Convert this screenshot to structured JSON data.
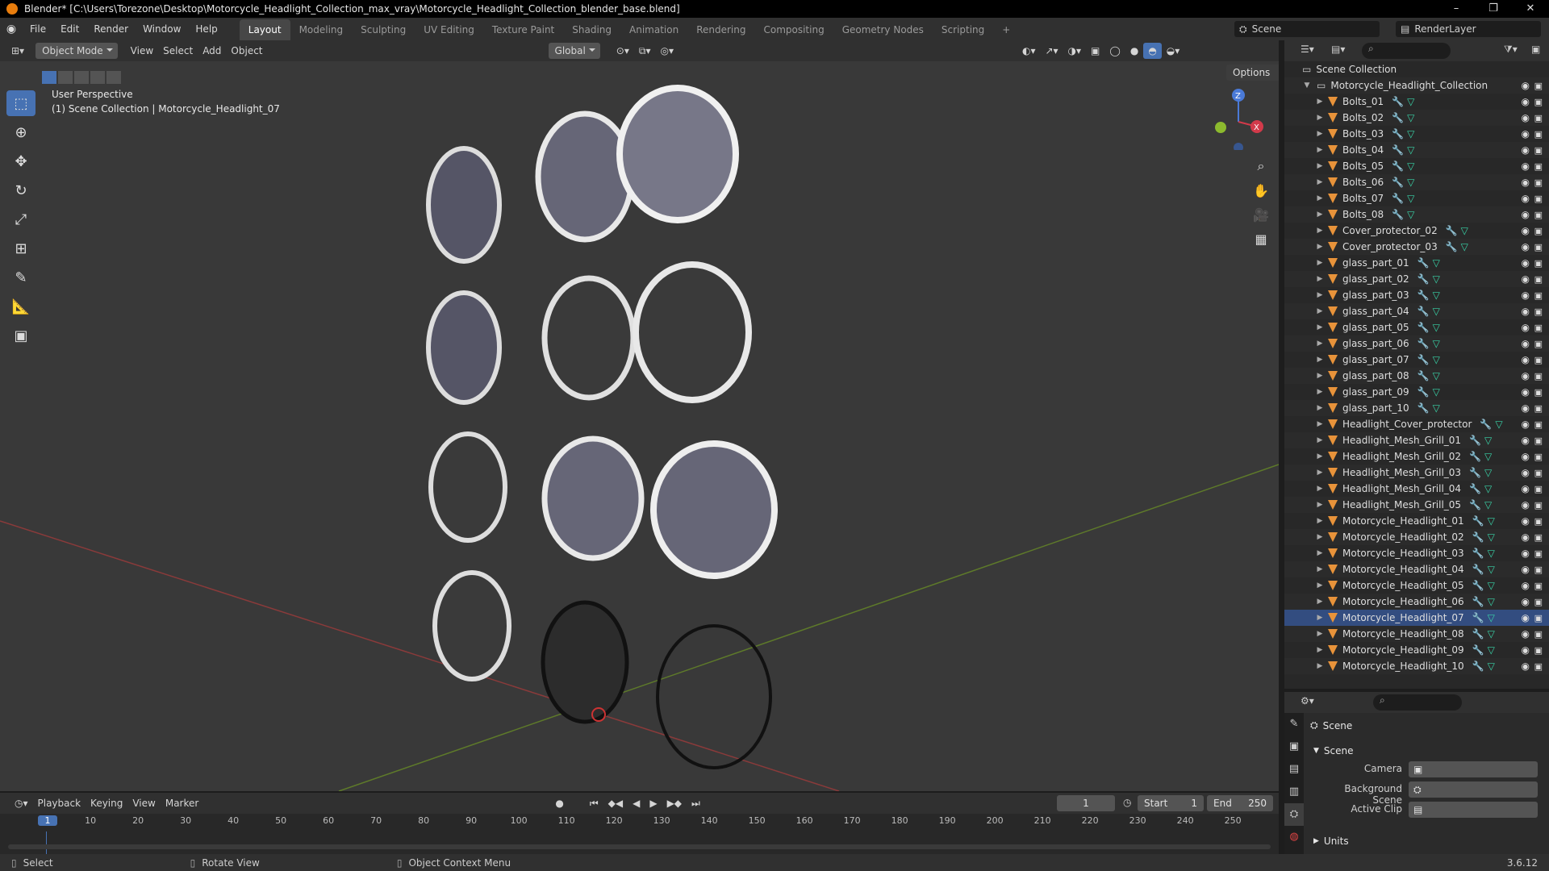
{
  "window": {
    "title": "Blender* [C:\\Users\\Torezone\\Desktop\\Motorcycle_Headlight_Collection_max_vray\\Motorcycle_Headlight_Collection_blender_base.blend]",
    "minimize": "–",
    "maximize": "❐",
    "close": "✕"
  },
  "menu": [
    "File",
    "Edit",
    "Render",
    "Window",
    "Help"
  ],
  "workspaces": [
    "Layout",
    "Modeling",
    "Sculpting",
    "UV Editing",
    "Texture Paint",
    "Shading",
    "Animation",
    "Rendering",
    "Compositing",
    "Geometry Nodes",
    "Scripting"
  ],
  "workspace_add": "+",
  "active_workspace": "Layout",
  "scene_selector": {
    "scene": "Scene",
    "view_layer": "RenderLayer"
  },
  "viewport_header": {
    "mode": "Object Mode",
    "menus": [
      "View",
      "Select",
      "Add",
      "Object"
    ],
    "transform_orientation": "Global",
    "options": "Options"
  },
  "viewport_info": {
    "line1": "User Perspective",
    "line2": "(1) Scene Collection | Motorcycle_Headlight_07"
  },
  "gizmo": {
    "z": "Z",
    "x": "X"
  },
  "outliner": {
    "root": "Scene Collection",
    "collection": "Motorcycle_Headlight_Collection",
    "items": [
      "Bolts_01",
      "Bolts_02",
      "Bolts_03",
      "Bolts_04",
      "Bolts_05",
      "Bolts_06",
      "Bolts_07",
      "Bolts_08",
      "Cover_protector_02",
      "Cover_protector_03",
      "glass_part_01",
      "glass_part_02",
      "glass_part_03",
      "glass_part_04",
      "glass_part_05",
      "glass_part_06",
      "glass_part_07",
      "glass_part_08",
      "glass_part_09",
      "glass_part_10",
      "Headlight_Cover_protector",
      "Headlight_Mesh_Grill_01",
      "Headlight_Mesh_Grill_02",
      "Headlight_Mesh_Grill_03",
      "Headlight_Mesh_Grill_04",
      "Headlight_Mesh_Grill_05",
      "Motorcycle_Headlight_01",
      "Motorcycle_Headlight_02",
      "Motorcycle_Headlight_03",
      "Motorcycle_Headlight_04",
      "Motorcycle_Headlight_05",
      "Motorcycle_Headlight_06",
      "Motorcycle_Headlight_07",
      "Motorcycle_Headlight_08",
      "Motorcycle_Headlight_09",
      "Motorcycle_Headlight_10"
    ]
  },
  "properties": {
    "context": "Scene",
    "panel": "Scene",
    "camera_label": "Camera",
    "background_label": "Background Scene",
    "clip_label": "Active Clip",
    "units_panel": "Units"
  },
  "timeline": {
    "menus": [
      "Playback",
      "Keying",
      "View",
      "Marker"
    ],
    "current_frame": "1",
    "start_label": "Start",
    "start": "1",
    "end_label": "End",
    "end": "250",
    "ticks": [
      "1",
      "10",
      "20",
      "30",
      "40",
      "50",
      "60",
      "70",
      "80",
      "90",
      "100",
      "110",
      "120",
      "130",
      "140",
      "150",
      "160",
      "170",
      "180",
      "190",
      "200",
      "210",
      "220",
      "230",
      "240",
      "250"
    ]
  },
  "statusbar": {
    "select": "Select",
    "rotate": "Rotate View",
    "context": "Object Context Menu",
    "version": "3.6.12"
  },
  "colors": {
    "accent": "#4772b3",
    "object": "#e8933a",
    "modifier": "#6e9ee6",
    "mesh": "#39d4a8",
    "axis_x": "#b53a3a",
    "axis_y": "#6f9a2a"
  }
}
